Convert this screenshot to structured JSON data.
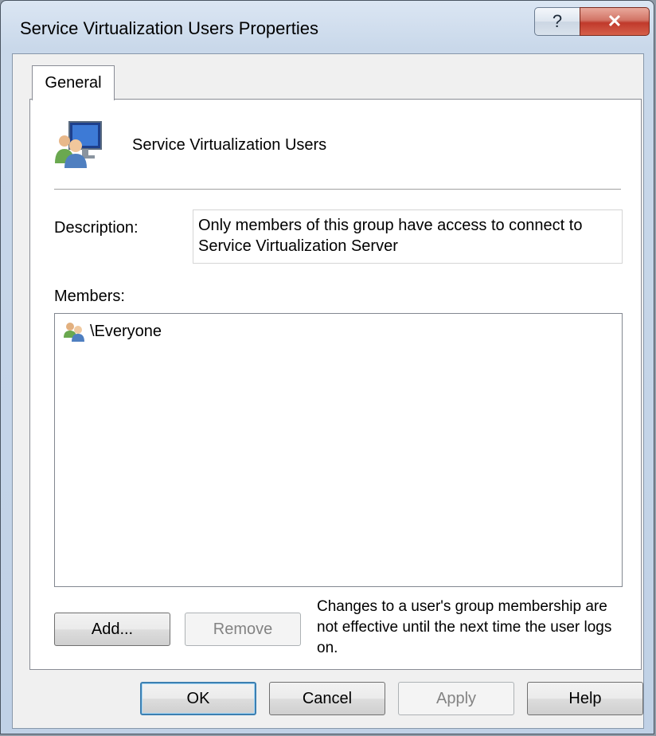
{
  "window": {
    "title": "Service Virtualization Users Properties",
    "help_glyph": "?",
    "close_glyph": "✕"
  },
  "tabs": [
    {
      "label": "General",
      "selected": true
    }
  ],
  "general": {
    "group_name": "Service Virtualization Users",
    "description_label": "Description:",
    "description_value": "Only members of this group have access to connect to Service Virtualization Server",
    "members_label": "Members:",
    "members": [
      {
        "name": "\\Everyone",
        "icon": "users-icon"
      }
    ],
    "add_label": "Add...",
    "remove_label": "Remove",
    "remove_enabled": false,
    "note": "Changes to a user's group membership are not effective until the next time the user logs on."
  },
  "footer": {
    "ok_label": "OK",
    "cancel_label": "Cancel",
    "apply_label": "Apply",
    "apply_enabled": false,
    "help_label": "Help"
  },
  "colors": {
    "title_close": "#c0392b",
    "default_button_border": "#3c7fb1"
  }
}
